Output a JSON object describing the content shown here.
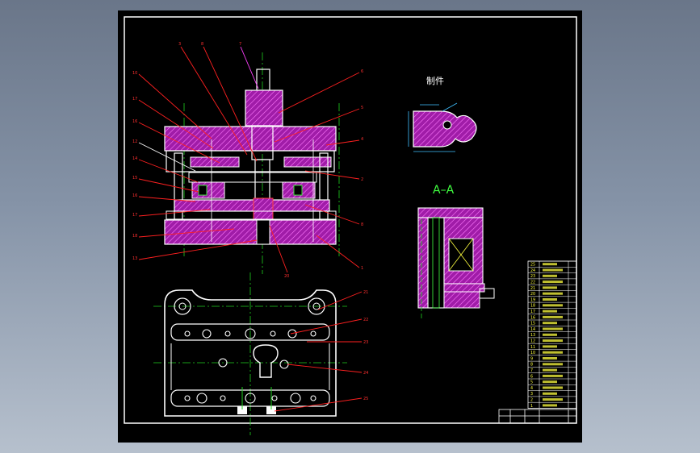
{
  "labels": {
    "part_title": "制件",
    "section_title": "A–A"
  },
  "balloons": {
    "left": [
      "10",
      "17",
      "16",
      "12",
      "14",
      "15",
      "16",
      "17",
      "18",
      "13"
    ],
    "top": [
      "3",
      "8",
      "7"
    ],
    "right": [
      "6",
      "5",
      "4",
      "2",
      "8",
      "1"
    ],
    "bottom": [
      "20"
    ],
    "plan_right": [
      "21",
      "22",
      "23",
      "24",
      "25"
    ]
  },
  "bom_rows": [
    "25",
    "24",
    "23",
    "22",
    "21",
    "20",
    "19",
    "18",
    "17",
    "16",
    "15",
    "14",
    "13",
    "12",
    "11",
    "10",
    "9",
    "8",
    "7",
    "6",
    "5",
    "4",
    "3",
    "2",
    "1"
  ],
  "colors": {
    "background": "#000000",
    "border": "#ffffff",
    "hatch": "#b020b0",
    "hatch_line": "#ff66ff",
    "leader": "#ff2020",
    "centerline": "#20d020",
    "label_text": "#ffffff",
    "section_text": "#40ff40",
    "bom_text": "#ffff00"
  }
}
